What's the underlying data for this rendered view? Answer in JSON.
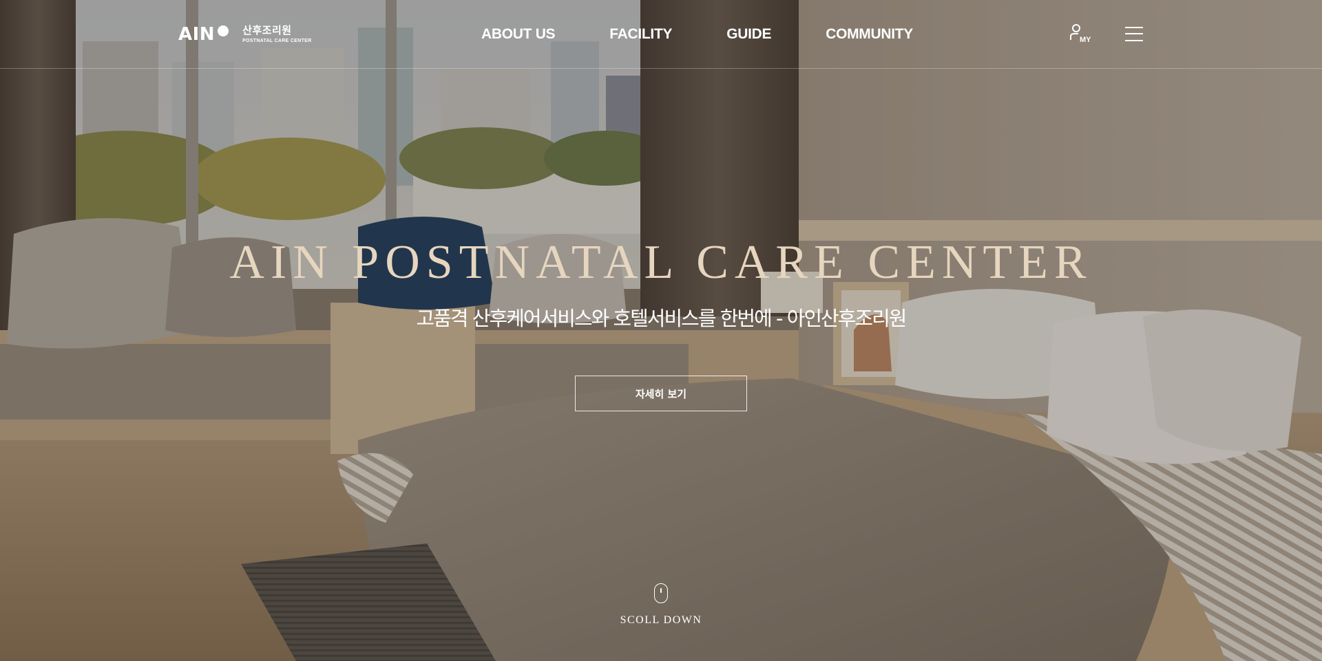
{
  "header": {
    "logo": {
      "main": "AIN",
      "korean": "산후조리원",
      "english": "POSTNATAL CARE CENTER"
    },
    "nav": [
      {
        "label": "ABOUT US"
      },
      {
        "label": "FACILITY"
      },
      {
        "label": "GUIDE"
      },
      {
        "label": "COMMUNITY"
      }
    ],
    "my_label": "MY",
    "menu_icon": "hamburger-menu-icon",
    "user_icon": "user-icon"
  },
  "hero": {
    "title": "AIN POSTNATAL CARE CENTER",
    "subtitle": "고품격 산후케어서비스와 호텔서비스를 한번에 - 아인산후조리원",
    "button_label": "자세히 보기",
    "scroll_label": "SCOLL DOWN",
    "scroll_icon": "mouse-icon"
  },
  "colors": {
    "title": "#e7d6bf",
    "text": "#ffffff"
  }
}
